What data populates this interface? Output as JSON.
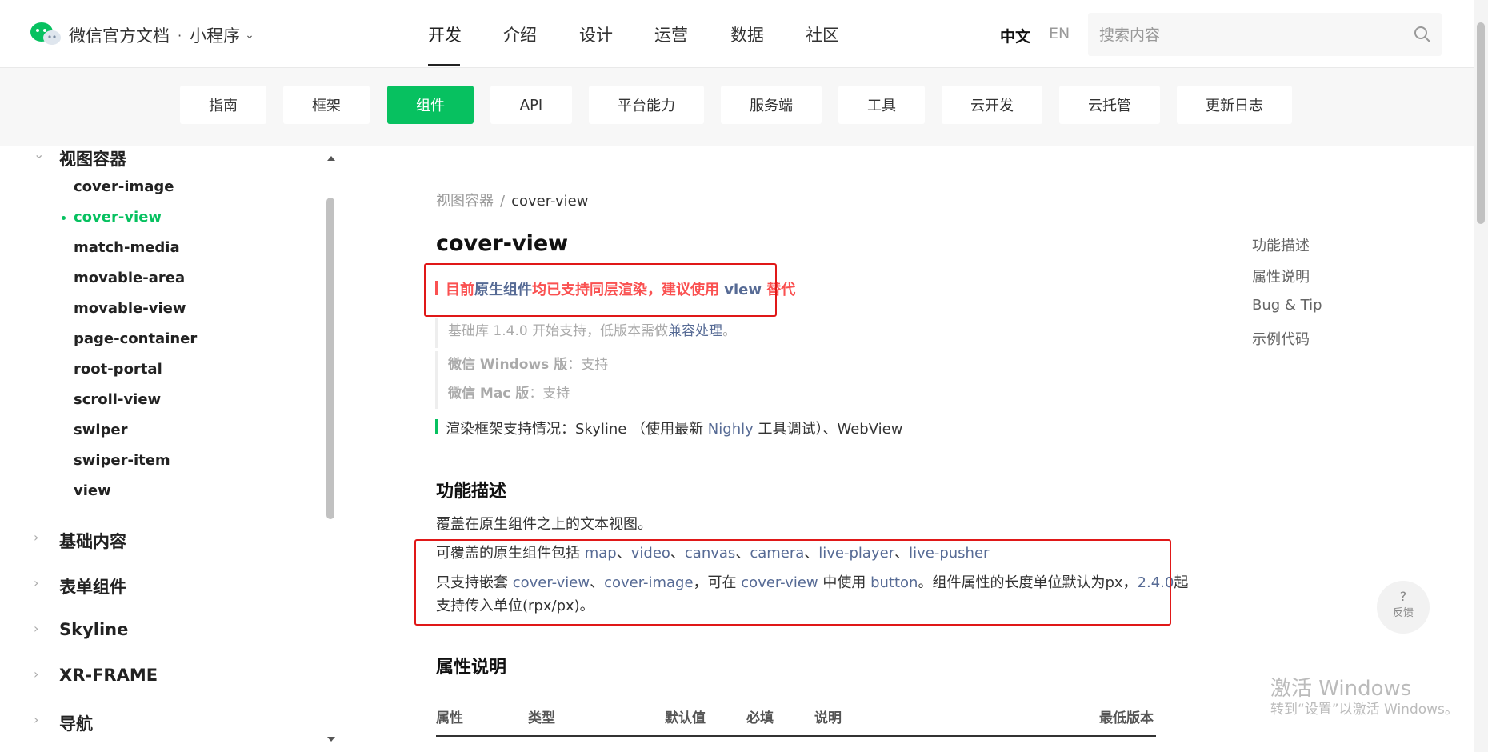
{
  "header": {
    "brand": "微信官方文档",
    "dot": "·",
    "product": "小程序",
    "nav": [
      "开发",
      "介绍",
      "设计",
      "运营",
      "数据",
      "社区"
    ],
    "active_nav": "开发",
    "lang_zh": "中文",
    "lang_en": "EN",
    "search_placeholder": "搜索内容"
  },
  "subnav": {
    "tabs": [
      "指南",
      "框架",
      "组件",
      "API",
      "平台能力",
      "服务端",
      "工具",
      "云开发",
      "云托管",
      "更新日志"
    ],
    "active": "组件"
  },
  "sidebar": {
    "open_section": "视图容器",
    "items": [
      "cover-image",
      "cover-view",
      "match-media",
      "movable-area",
      "movable-view",
      "page-container",
      "root-portal",
      "scroll-view",
      "swiper",
      "swiper-item",
      "view"
    ],
    "active_item": "cover-view",
    "sections": [
      "基础内容",
      "表单组件",
      "Skyline",
      "XR-FRAME",
      "导航"
    ]
  },
  "breadcrumb": {
    "parent": "视图容器",
    "sep": "/",
    "current": "cover-view"
  },
  "title": "cover-view",
  "notice": {
    "p1": "目前",
    "link1": "原生组件",
    "p2": "均已支持同层渲染，建议使用 ",
    "link2": "view",
    "p3": " 替代"
  },
  "support": {
    "base_p1": "基础库 1.4.0 开始支持，低版本需做",
    "base_link": "兼容处理",
    "base_p2": "。",
    "win_label": "微信 Windows 版",
    "win_value": "：支持",
    "mac_label": "微信 Mac 版",
    "mac_value": "：支持"
  },
  "render": {
    "p1": "渲染框架支持情况：Skyline （使用最新 ",
    "link": "Nighly",
    "p2": " 工具调试）、WebView"
  },
  "section1": {
    "title": "功能描述",
    "desc": "覆盖在原生组件之上的文本视图。",
    "l1_prefix": "可覆盖的原生组件包括 ",
    "l1_links": [
      "map",
      "video",
      "canvas",
      "camera",
      "live-player",
      "live-pusher"
    ],
    "l1_sep": "、",
    "l2_p1": "只支持嵌套 ",
    "l2_link1": "cover-view",
    "l2_sep": "、",
    "l2_link2": "cover-image",
    "l2_p2": "，可在 ",
    "l2_link3": "cover-view",
    "l2_p3": " 中使用 ",
    "l2_link4": "button",
    "l2_p4": "。组件属性的长度单位默认为px，",
    "l2_link5": "2.4.0",
    "l2_p5": "起",
    "l3": "支持传入单位(rpx/px)。"
  },
  "section2": {
    "title": "属性说明",
    "columns": [
      "属性",
      "类型",
      "默认值",
      "必填",
      "说明",
      "最低版本"
    ]
  },
  "toc": [
    "功能描述",
    "属性说明",
    "Bug & Tip",
    "示例代码"
  ],
  "feedback": {
    "q": "?",
    "label": "反馈"
  },
  "watermark": {
    "title": "激活 Windows",
    "sub": "转到“设置”以激活 Windows。"
  },
  "colors": {
    "green": "#07c160",
    "link": "#576b95",
    "red": "#fa5151",
    "annotation": "#e01818"
  }
}
